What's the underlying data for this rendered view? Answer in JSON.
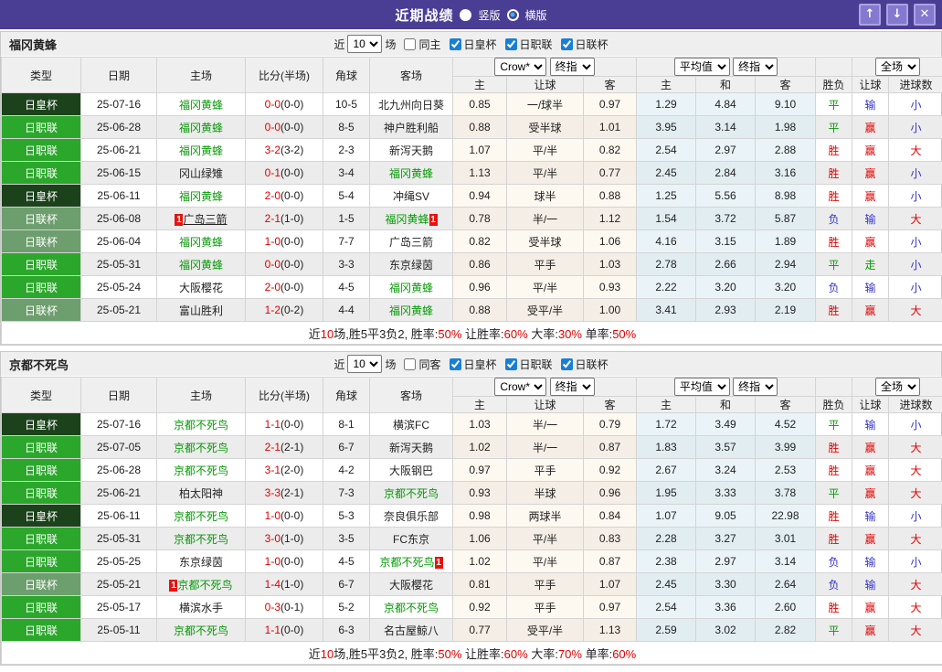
{
  "titlebar": {
    "title": "近期战绩",
    "vertical_label": "竖版",
    "horizontal_label": "横版",
    "selected_layout": "横版",
    "up_glyph": "↑",
    "down_glyph": "↓",
    "close_glyph": "✕"
  },
  "colors": {
    "titlebar_bg": "#4a3e94",
    "header_bg": "#efefef",
    "league_cup": "#1b421b",
    "league_j1": "#2ba72b",
    "league_lcup": "#6d9e6d",
    "team_green": "#089908",
    "score_red": "#e00000",
    "win_red": "#e00000",
    "draw_green": "#089908",
    "lose_blue": "#3333cc",
    "crow_bg": "#fdf8f0",
    "avg_bg": "#eaf4f8",
    "badge_red": "#e8120e"
  },
  "league_class": {
    "日皇杯": "league-cup",
    "日职联": "league-j1",
    "日联杯": "league-lcup"
  },
  "result_class": {
    "胜": "r",
    "赢": "r",
    "大": "r",
    "平": "g",
    "走": "g",
    "负": "b",
    "输": "b",
    "小": "b"
  },
  "columns": {
    "type": "类型",
    "date": "日期",
    "home": "主场",
    "score": "比分(半场)",
    "corner": "角球",
    "away": "客场",
    "crow_select": "Crow*",
    "crow_final_select": "终指",
    "avg_select": "平均值",
    "avg_final_select": "终指",
    "full_select": "全场",
    "sub": [
      "主",
      "让球",
      "客",
      "主",
      "和",
      "客",
      "胜负",
      "让球",
      "进球数"
    ]
  },
  "tables": [
    {
      "team": "福冈黄蜂",
      "filter": {
        "near": "近",
        "count": "10",
        "unit": "场",
        "same": {
          "label": "同主",
          "checked": false
        },
        "cups": [
          {
            "label": "日皇杯",
            "checked": true
          },
          {
            "label": "日职联",
            "checked": true
          },
          {
            "label": "日联杯",
            "checked": true
          }
        ]
      },
      "rows": [
        {
          "league": "日皇杯",
          "date": "25-07-16",
          "home": {
            "name": "福冈黄蜂",
            "green": true
          },
          "score": "0-0",
          "half": "(0-0)",
          "corner": "10-5",
          "away": {
            "name": "北九州向日葵",
            "green": false
          },
          "crow": [
            "0.85",
            "一/球半",
            "0.97"
          ],
          "avg": [
            "1.29",
            "4.84",
            "9.10"
          ],
          "result": [
            "平",
            "输",
            "小"
          ]
        },
        {
          "league": "日职联",
          "date": "25-06-28",
          "home": {
            "name": "福冈黄蜂",
            "green": true
          },
          "score": "0-0",
          "half": "(0-0)",
          "corner": "8-5",
          "away": {
            "name": "神户胜利船",
            "green": false
          },
          "crow": [
            "0.88",
            "受半球",
            "1.01"
          ],
          "avg": [
            "3.95",
            "3.14",
            "1.98"
          ],
          "result": [
            "平",
            "赢",
            "小"
          ]
        },
        {
          "league": "日职联",
          "date": "25-06-21",
          "home": {
            "name": "福冈黄蜂",
            "green": true
          },
          "score": "3-2",
          "half": "(3-2)",
          "corner": "2-3",
          "away": {
            "name": "新泻天鹅",
            "green": false
          },
          "crow": [
            "1.07",
            "平/半",
            "0.82"
          ],
          "avg": [
            "2.54",
            "2.97",
            "2.88"
          ],
          "result": [
            "胜",
            "赢",
            "大"
          ]
        },
        {
          "league": "日职联",
          "date": "25-06-15",
          "home": {
            "name": "冈山绿雉",
            "green": false
          },
          "score": "0-1",
          "half": "(0-0)",
          "corner": "3-4",
          "away": {
            "name": "福冈黄蜂",
            "green": true
          },
          "crow": [
            "1.13",
            "平/半",
            "0.77"
          ],
          "avg": [
            "2.45",
            "2.84",
            "3.16"
          ],
          "result": [
            "胜",
            "赢",
            "小"
          ]
        },
        {
          "league": "日皇杯",
          "date": "25-06-11",
          "home": {
            "name": "福冈黄蜂",
            "green": true
          },
          "score": "2-0",
          "half": "(0-0)",
          "corner": "5-4",
          "away": {
            "name": "冲绳SV",
            "green": false
          },
          "crow": [
            "0.94",
            "球半",
            "0.88"
          ],
          "avg": [
            "1.25",
            "5.56",
            "8.98"
          ],
          "result": [
            "胜",
            "赢",
            "小"
          ]
        },
        {
          "league": "日联杯",
          "date": "25-06-08",
          "home": {
            "name": "广岛三箭",
            "green": false,
            "badge": "before",
            "underline": true
          },
          "score": "2-1",
          "half": "(1-0)",
          "corner": "1-5",
          "away": {
            "name": "福冈黄蜂",
            "green": true,
            "badge": "after"
          },
          "crow": [
            "0.78",
            "半/一",
            "1.12"
          ],
          "avg": [
            "1.54",
            "3.72",
            "5.87"
          ],
          "result": [
            "负",
            "输",
            "大"
          ]
        },
        {
          "league": "日联杯",
          "date": "25-06-04",
          "home": {
            "name": "福冈黄蜂",
            "green": true
          },
          "score": "1-0",
          "half": "(0-0)",
          "corner": "7-7",
          "away": {
            "name": "广岛三箭",
            "green": false
          },
          "crow": [
            "0.82",
            "受半球",
            "1.06"
          ],
          "avg": [
            "4.16",
            "3.15",
            "1.89"
          ],
          "result": [
            "胜",
            "赢",
            "小"
          ]
        },
        {
          "league": "日职联",
          "date": "25-05-31",
          "home": {
            "name": "福冈黄蜂",
            "green": true
          },
          "score": "0-0",
          "half": "(0-0)",
          "corner": "3-3",
          "away": {
            "name": "东京绿茵",
            "green": false
          },
          "crow": [
            "0.86",
            "平手",
            "1.03"
          ],
          "avg": [
            "2.78",
            "2.66",
            "2.94"
          ],
          "result": [
            "平",
            "走",
            "小"
          ]
        },
        {
          "league": "日职联",
          "date": "25-05-24",
          "home": {
            "name": "大阪樱花",
            "green": false
          },
          "score": "2-0",
          "half": "(0-0)",
          "corner": "4-5",
          "away": {
            "name": "福冈黄蜂",
            "green": true
          },
          "crow": [
            "0.96",
            "平/半",
            "0.93"
          ],
          "avg": [
            "2.22",
            "3.20",
            "3.20"
          ],
          "result": [
            "负",
            "输",
            "小"
          ]
        },
        {
          "league": "日联杯",
          "date": "25-05-21",
          "home": {
            "name": "富山胜利",
            "green": false
          },
          "score": "1-2",
          "half": "(0-2)",
          "corner": "4-4",
          "away": {
            "name": "福冈黄蜂",
            "green": true
          },
          "crow": [
            "0.88",
            "受平/半",
            "1.00"
          ],
          "avg": [
            "3.41",
            "2.93",
            "2.19"
          ],
          "result": [
            "胜",
            "赢",
            "大"
          ]
        }
      ],
      "summary": [
        {
          "t": "近"
        },
        {
          "t": "10",
          "red": true
        },
        {
          "t": "场,胜5平3负2, 胜率:"
        },
        {
          "t": "50%",
          "red": true
        },
        {
          "t": " 让胜率:"
        },
        {
          "t": "60%",
          "red": true
        },
        {
          "t": " 大率:"
        },
        {
          "t": "30%",
          "red": true
        },
        {
          "t": " 单率:"
        },
        {
          "t": "50%",
          "red": true
        }
      ]
    },
    {
      "team": "京都不死鸟",
      "filter": {
        "near": "近",
        "count": "10",
        "unit": "场",
        "same": {
          "label": "同客",
          "checked": false
        },
        "cups": [
          {
            "label": "日皇杯",
            "checked": true
          },
          {
            "label": "日职联",
            "checked": true
          },
          {
            "label": "日联杯",
            "checked": true
          }
        ]
      },
      "rows": [
        {
          "league": "日皇杯",
          "date": "25-07-16",
          "home": {
            "name": "京都不死鸟",
            "green": true
          },
          "score": "1-1",
          "half": "(0-0)",
          "corner": "8-1",
          "away": {
            "name": "横滨FC",
            "green": false
          },
          "crow": [
            "1.03",
            "半/一",
            "0.79"
          ],
          "avg": [
            "1.72",
            "3.49",
            "4.52"
          ],
          "result": [
            "平",
            "输",
            "小"
          ]
        },
        {
          "league": "日职联",
          "date": "25-07-05",
          "home": {
            "name": "京都不死鸟",
            "green": true
          },
          "score": "2-1",
          "half": "(2-1)",
          "corner": "6-7",
          "away": {
            "name": "新泻天鹅",
            "green": false
          },
          "crow": [
            "1.02",
            "半/一",
            "0.87"
          ],
          "avg": [
            "1.83",
            "3.57",
            "3.99"
          ],
          "result": [
            "胜",
            "赢",
            "大"
          ]
        },
        {
          "league": "日职联",
          "date": "25-06-28",
          "home": {
            "name": "京都不死鸟",
            "green": true
          },
          "score": "3-1",
          "half": "(2-0)",
          "corner": "4-2",
          "away": {
            "name": "大阪钢巴",
            "green": false
          },
          "crow": [
            "0.97",
            "平手",
            "0.92"
          ],
          "avg": [
            "2.67",
            "3.24",
            "2.53"
          ],
          "result": [
            "胜",
            "赢",
            "大"
          ]
        },
        {
          "league": "日职联",
          "date": "25-06-21",
          "home": {
            "name": "柏太阳神",
            "green": false
          },
          "score": "3-3",
          "half": "(2-1)",
          "corner": "7-3",
          "away": {
            "name": "京都不死鸟",
            "green": true
          },
          "crow": [
            "0.93",
            "半球",
            "0.96"
          ],
          "avg": [
            "1.95",
            "3.33",
            "3.78"
          ],
          "result": [
            "平",
            "赢",
            "大"
          ]
        },
        {
          "league": "日皇杯",
          "date": "25-06-11",
          "home": {
            "name": "京都不死鸟",
            "green": true
          },
          "score": "1-0",
          "half": "(0-0)",
          "corner": "5-3",
          "away": {
            "name": "奈良俱乐部",
            "green": false
          },
          "crow": [
            "0.98",
            "两球半",
            "0.84"
          ],
          "avg": [
            "1.07",
            "9.05",
            "22.98"
          ],
          "result": [
            "胜",
            "输",
            "小"
          ]
        },
        {
          "league": "日职联",
          "date": "25-05-31",
          "home": {
            "name": "京都不死鸟",
            "green": true
          },
          "score": "3-0",
          "half": "(1-0)",
          "corner": "3-5",
          "away": {
            "name": "FC东京",
            "green": false
          },
          "crow": [
            "1.06",
            "平/半",
            "0.83"
          ],
          "avg": [
            "2.28",
            "3.27",
            "3.01"
          ],
          "result": [
            "胜",
            "赢",
            "大"
          ]
        },
        {
          "league": "日职联",
          "date": "25-05-25",
          "home": {
            "name": "东京绿茵",
            "green": false
          },
          "score": "1-0",
          "half": "(0-0)",
          "corner": "4-5",
          "away": {
            "name": "京都不死鸟",
            "green": true,
            "badge": "after"
          },
          "crow": [
            "1.02",
            "平/半",
            "0.87"
          ],
          "avg": [
            "2.38",
            "2.97",
            "3.14"
          ],
          "result": [
            "负",
            "输",
            "小"
          ]
        },
        {
          "league": "日联杯",
          "date": "25-05-21",
          "home": {
            "name": "京都不死鸟",
            "green": true,
            "badge": "before"
          },
          "score": "1-4",
          "half": "(1-0)",
          "corner": "6-7",
          "away": {
            "name": "大阪樱花",
            "green": false
          },
          "crow": [
            "0.81",
            "平手",
            "1.07"
          ],
          "avg": [
            "2.45",
            "3.30",
            "2.64"
          ],
          "result": [
            "负",
            "输",
            "大"
          ]
        },
        {
          "league": "日职联",
          "date": "25-05-17",
          "home": {
            "name": "横滨水手",
            "green": false
          },
          "score": "0-3",
          "half": "(0-1)",
          "corner": "5-2",
          "away": {
            "name": "京都不死鸟",
            "green": true
          },
          "crow": [
            "0.92",
            "平手",
            "0.97"
          ],
          "avg": [
            "2.54",
            "3.36",
            "2.60"
          ],
          "result": [
            "胜",
            "赢",
            "大"
          ]
        },
        {
          "league": "日职联",
          "date": "25-05-11",
          "home": {
            "name": "京都不死鸟",
            "green": true
          },
          "score": "1-1",
          "half": "(0-0)",
          "corner": "6-3",
          "away": {
            "name": "名古屋鲸八",
            "green": false
          },
          "crow": [
            "0.77",
            "受平/半",
            "1.13"
          ],
          "avg": [
            "2.59",
            "3.02",
            "2.82"
          ],
          "result": [
            "平",
            "赢",
            "大"
          ]
        }
      ],
      "summary": [
        {
          "t": "近"
        },
        {
          "t": "10",
          "red": true
        },
        {
          "t": "场,胜5平3负2, 胜率:"
        },
        {
          "t": "50%",
          "red": true
        },
        {
          "t": " 让胜率:"
        },
        {
          "t": "60%",
          "red": true
        },
        {
          "t": " 大率:"
        },
        {
          "t": "70%",
          "red": true
        },
        {
          "t": " 单率:"
        },
        {
          "t": "60%",
          "red": true
        }
      ]
    }
  ]
}
